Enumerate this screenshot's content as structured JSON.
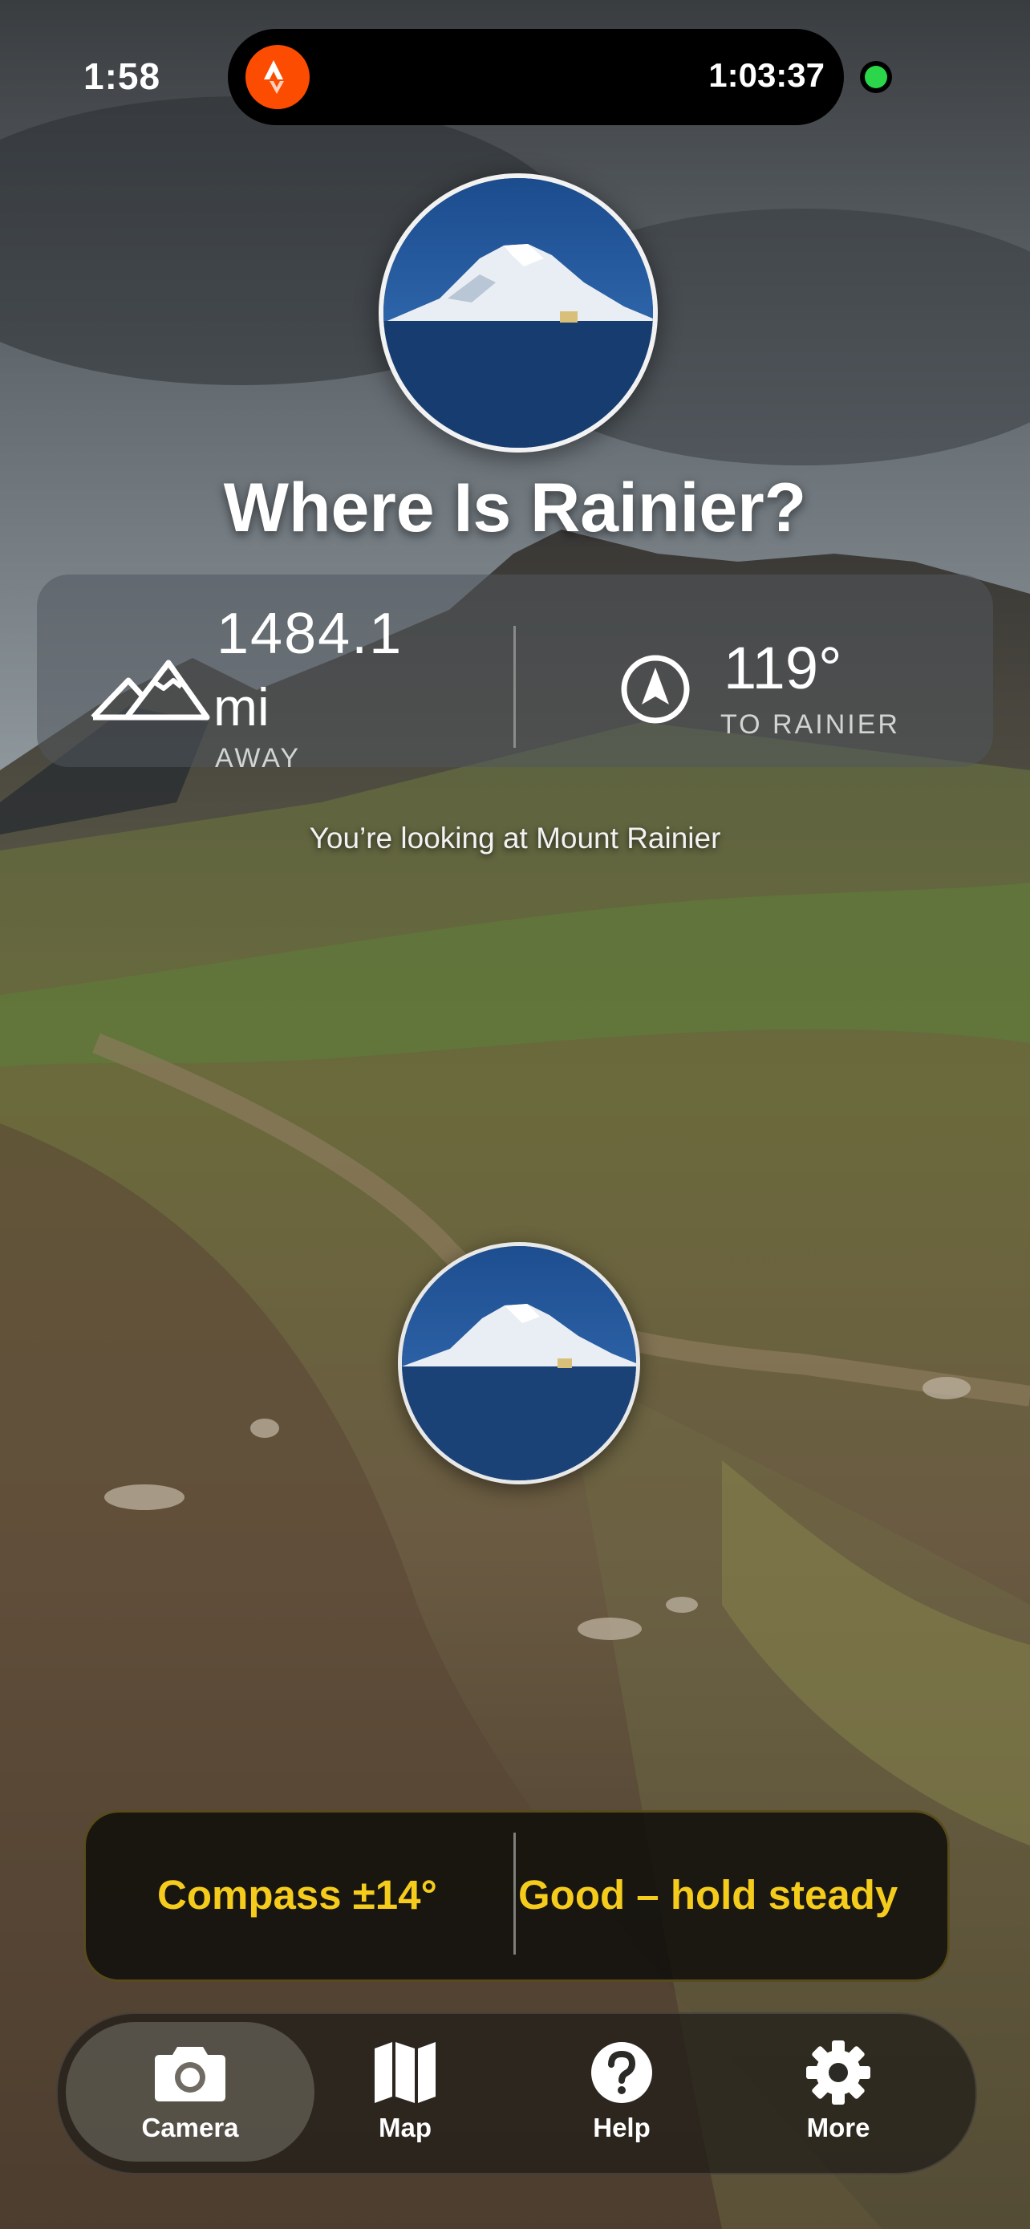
{
  "status_bar": {
    "time": "1:58",
    "live_activity": {
      "app_icon": "strava-activity-icon",
      "timer": "1:03:37"
    },
    "camera_indicator_color": "#2bd64a"
  },
  "app": {
    "title": "Where Is Rainier?",
    "logo_icon": "mount-rainier-photo"
  },
  "distance": {
    "value": "1484.1",
    "unit": "mi",
    "caption": "AWAY",
    "icon": "mountains-icon"
  },
  "bearing": {
    "value": "119°",
    "caption": "TO RAINIER",
    "icon": "compass-arrow-icon"
  },
  "status_message": "You’re looking at Mount Rainier",
  "accuracy": {
    "compass": "Compass ±14°",
    "quality": "Good – hold steady",
    "accent_color": "#f5cc1c"
  },
  "tabs": [
    {
      "label": "Camera",
      "icon": "camera-icon",
      "active": true
    },
    {
      "label": "Map",
      "icon": "map-icon",
      "active": false
    },
    {
      "label": "Help",
      "icon": "help-icon",
      "active": false
    },
    {
      "label": "More",
      "icon": "gear-icon",
      "active": false
    }
  ]
}
